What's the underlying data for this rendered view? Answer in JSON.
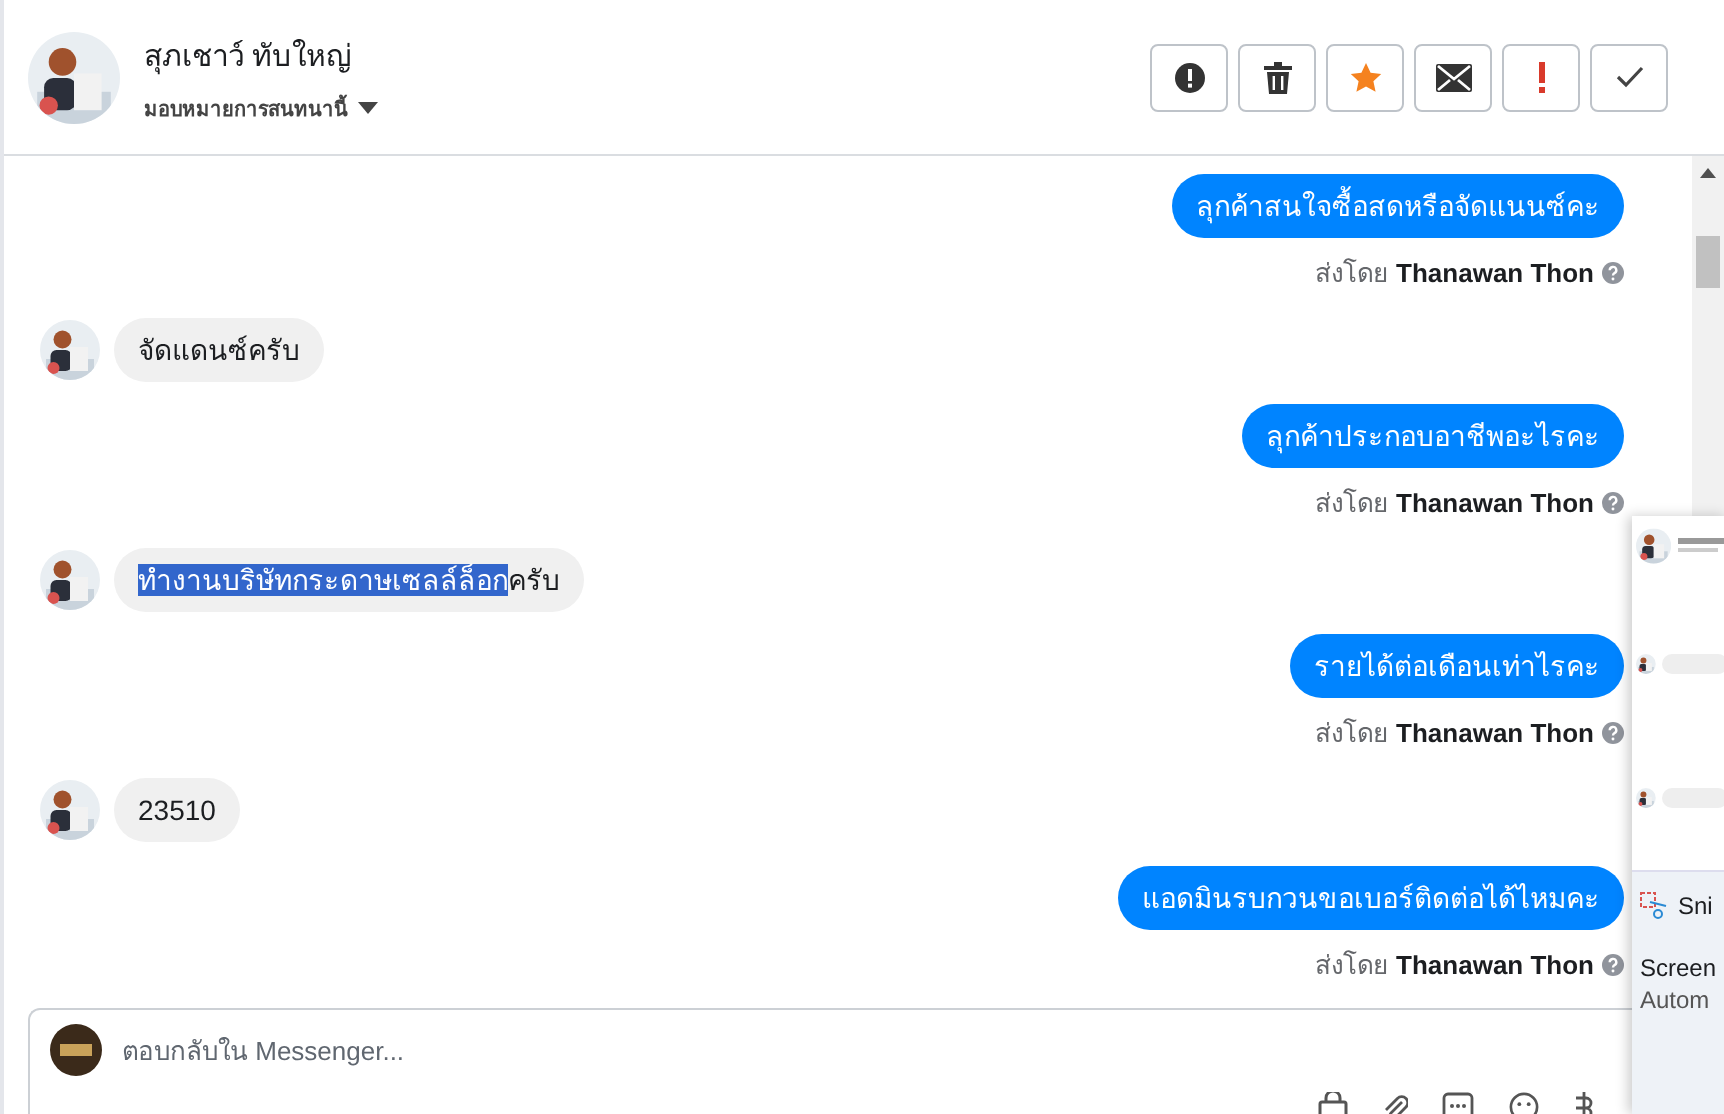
{
  "contact": {
    "name": "สุภเชาว์ ทับใหญ่",
    "assign": "มอบหมายการสนทนานี้"
  },
  "actions": [
    {
      "kind": "spam"
    },
    {
      "kind": "delete"
    },
    {
      "kind": "star"
    },
    {
      "kind": "unread"
    },
    {
      "kind": "important"
    },
    {
      "kind": "done"
    }
  ],
  "messages": [
    {
      "kind": "outgoing",
      "parts": [
        {
          "text": "ลุกค้าสนใจซื้อสดหรือจัดแนนซ์คะ",
          "selected": false
        }
      ],
      "sent_by": "ส่งโดย",
      "sender": "Thanawan Thon"
    },
    {
      "kind": "incoming",
      "parts": [
        {
          "text": "จัดแดนซ์ครับ",
          "selected": false
        }
      ]
    },
    {
      "kind": "outgoing",
      "parts": [
        {
          "text": "ลุกค้าประกอบอาชีพอะไรคะ",
          "selected": false
        }
      ],
      "sent_by": "ส่งโดย",
      "sender": "Thanawan Thon"
    },
    {
      "kind": "incoming",
      "parts": [
        {
          "text": "ทำงานบริษัทกระดาษเซลล์ล็อก",
          "selected": true
        },
        {
          "text": "ครับ",
          "selected": false
        }
      ]
    },
    {
      "kind": "outgoing",
      "parts": [
        {
          "text": "รายได้ต่อเดือนเท่าไรคะ",
          "selected": false
        }
      ],
      "sent_by": "ส่งโดย",
      "sender": "Thanawan Thon"
    },
    {
      "kind": "incoming",
      "parts": [
        {
          "text": "23510",
          "selected": false
        }
      ]
    },
    {
      "kind": "outgoing",
      "parts": [
        {
          "text": "แอดมินรบกวนขอเบอร์ติดต่อได้ไหมคะ",
          "selected": false
        }
      ],
      "sent_by": "ส่งโดย",
      "sender": "Thanawan Thon"
    }
  ],
  "composer": {
    "placeholder": "ตอบกลับใน Messenger..."
  },
  "notification": {
    "app": "Sni",
    "title": "Screen",
    "body": "Autom"
  }
}
